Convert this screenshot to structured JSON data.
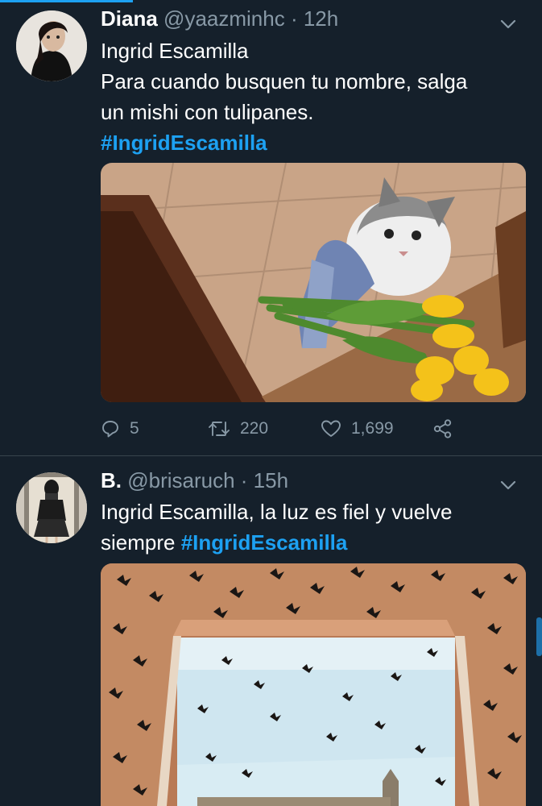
{
  "tweets": [
    {
      "name": "Diana",
      "handle": "@yaazminhc",
      "time": "· 12h",
      "text_lines": [
        "Ingrid Escamilla",
        "Para cuando busquen tu nombre, salga",
        "un mishi con tulipanes."
      ],
      "hashtag": "#IngridEscamilla",
      "media": "cat-with-tulips-photo",
      "replies": "5",
      "retweets": "220",
      "likes": "1,699"
    },
    {
      "name": "B.",
      "handle": "@brisaruch",
      "time": "· 15h",
      "text_line1": "Ingrid Escamilla, la luz es fiel y vuelve",
      "text_line2_prefix": "siempre ",
      "hashtag": "#IngridEscamilla",
      "media": "window-with-black-butterflies-photo"
    }
  ],
  "colors": {
    "background": "#15202b",
    "accent": "#1da1f2",
    "secondary_text": "#8899a6",
    "divider": "#38444d"
  },
  "icons": [
    "reply-icon",
    "retweet-icon",
    "like-icon",
    "share-icon",
    "chevron-down-icon"
  ]
}
